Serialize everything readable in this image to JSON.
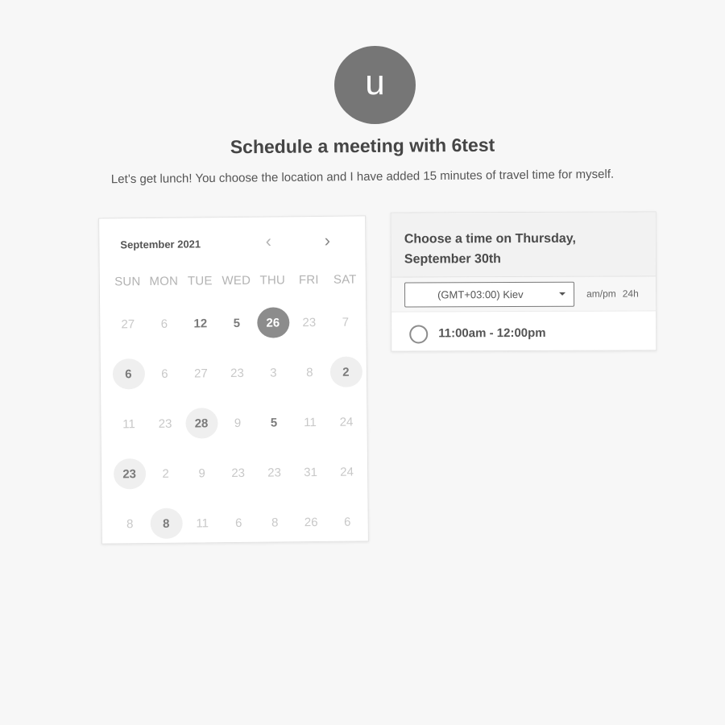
{
  "host": {
    "avatar_initial": "u",
    "title": "Schedule a meeting with 6test",
    "description": "Let’s get lunch! You choose the location and I have added 15 minutes of travel time for myself."
  },
  "calendar": {
    "month_label": "September 2021",
    "prev_icon": "chevron-left-icon",
    "next_icon": "chevron-right-icon",
    "prev_glyph": "‹",
    "next_glyph": "›",
    "weekdays": [
      "SUN",
      "MON",
      "TUE",
      "WED",
      "THU",
      "FRI",
      "SAT"
    ],
    "weeks": [
      [
        {
          "label": "27",
          "state": "disabled"
        },
        {
          "label": "6",
          "state": "disabled"
        },
        {
          "label": "12",
          "state": "active"
        },
        {
          "label": "5",
          "state": "active"
        },
        {
          "label": "26",
          "state": "selected"
        },
        {
          "label": "23",
          "state": "disabled"
        },
        {
          "label": "7",
          "state": "disabled"
        }
      ],
      [
        {
          "label": "6",
          "state": "available"
        },
        {
          "label": "6",
          "state": "disabled"
        },
        {
          "label": "27",
          "state": "disabled"
        },
        {
          "label": "23",
          "state": "disabled"
        },
        {
          "label": "3",
          "state": "disabled"
        },
        {
          "label": "8",
          "state": "disabled"
        },
        {
          "label": "2",
          "state": "available"
        }
      ],
      [
        {
          "label": "11",
          "state": "disabled"
        },
        {
          "label": "23",
          "state": "disabled"
        },
        {
          "label": "28",
          "state": "available"
        },
        {
          "label": "9",
          "state": "disabled"
        },
        {
          "label": "5",
          "state": "active"
        },
        {
          "label": "11",
          "state": "disabled"
        },
        {
          "label": "24",
          "state": "disabled"
        }
      ],
      [
        {
          "label": "23",
          "state": "available"
        },
        {
          "label": "2",
          "state": "disabled"
        },
        {
          "label": "9",
          "state": "disabled"
        },
        {
          "label": "23",
          "state": "disabled"
        },
        {
          "label": "23",
          "state": "disabled"
        },
        {
          "label": "31",
          "state": "disabled"
        },
        {
          "label": "24",
          "state": "disabled"
        }
      ],
      [
        {
          "label": "8",
          "state": "disabled"
        },
        {
          "label": "8",
          "state": "available"
        },
        {
          "label": "11",
          "state": "disabled"
        },
        {
          "label": "6",
          "state": "disabled"
        },
        {
          "label": "8",
          "state": "disabled"
        },
        {
          "label": "26",
          "state": "disabled"
        },
        {
          "label": "6",
          "state": "disabled"
        }
      ]
    ]
  },
  "times": {
    "header": "Choose a time on Thursday, September 30th",
    "timezone": {
      "selected": "(GMT+03:00) Kiev",
      "icon": "caret-down-icon"
    },
    "format_options": [
      "am/pm",
      "24h"
    ],
    "slots": [
      {
        "label": "11:00am - 12:00pm",
        "selected": false
      }
    ]
  },
  "colors": {
    "background": "#f7f7f7",
    "card": "#ffffff",
    "selected_day": "#8c8c8c",
    "available_day": "#efefef",
    "avatar": "#767676"
  }
}
